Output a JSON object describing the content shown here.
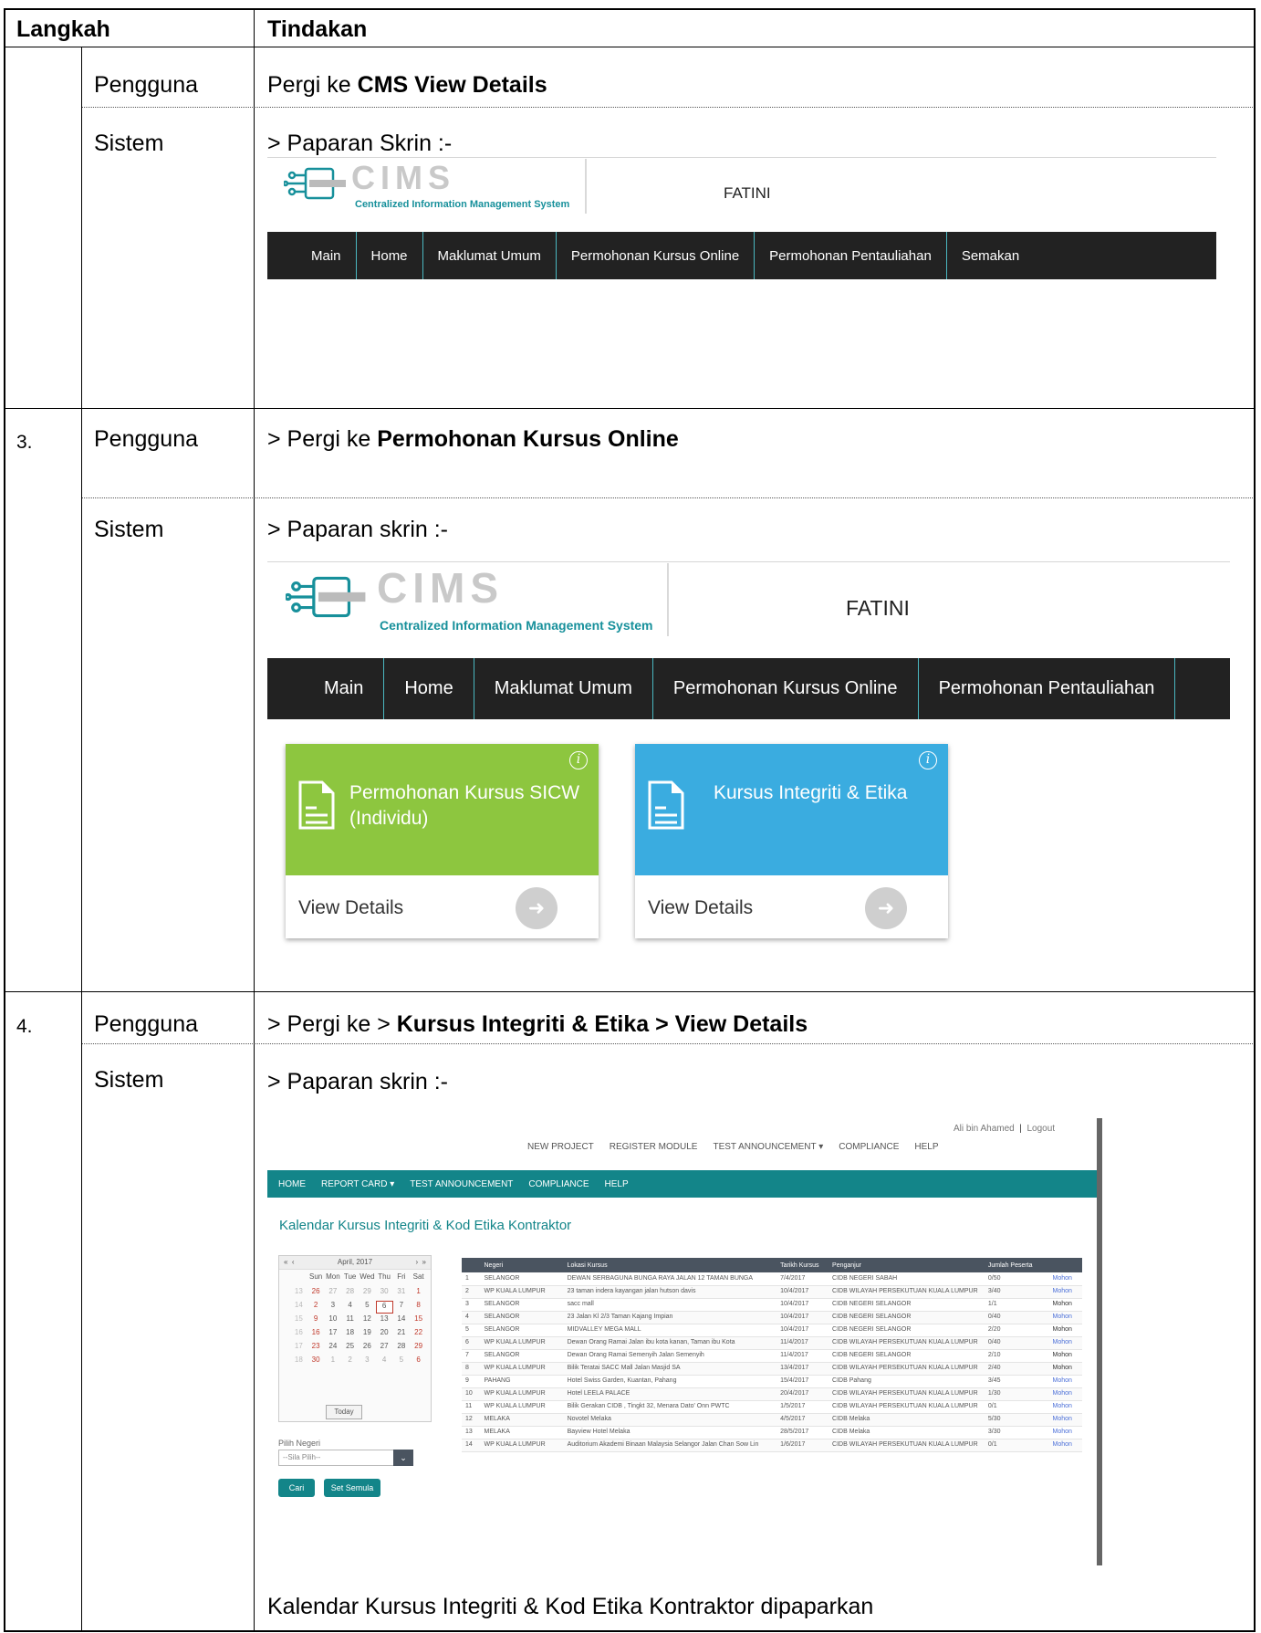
{
  "table": {
    "header_left": "Langkah",
    "header_right": "Tindakan"
  },
  "rows": [
    {
      "num": "",
      "actor": "Pengguna",
      "text_prefix": "Pergi ke ",
      "text_bold": "CMS View Details"
    },
    {
      "num": "",
      "actor": "Sistem",
      "text": "> Paparan Skrin :-"
    },
    {
      "num": "3.",
      "actor": "Pengguna",
      "text_prefix": "> Pergi ke ",
      "text_bold": "Permohonan Kursus Online"
    },
    {
      "num": "",
      "actor": "Sistem",
      "text": "> Paparan skrin :-"
    },
    {
      "num": "4.",
      "actor": "Pengguna",
      "text_prefix": "> Pergi ke > ",
      "text_bold": "Kursus Integriti & Etika > View Details"
    },
    {
      "num": "",
      "actor": "Sistem",
      "text": "> Paparan skrin :-"
    }
  ],
  "footer_text": "Kalendar Kursus Integriti & Kod Etika Kontraktor dipaparkan",
  "cims": {
    "logo_text": "CIMS",
    "subtitle": "Centralized Information Management System",
    "user": "FATINI",
    "nav": [
      "Main",
      "Home",
      "Maklumat Umum",
      "Permohonan Kursus Online",
      "Permohonan Pentauliahan",
      "Semakan"
    ]
  },
  "tiles": [
    {
      "title": "Permohonan Kursus SICW (Individu)",
      "link": "View Details",
      "color": "#8dc63f"
    },
    {
      "title": "Kursus Integriti & Etika",
      "link": "View Details",
      "color": "#3aace0"
    }
  ],
  "kal": {
    "user": "Ali bin Ahamed",
    "logout": "Logout",
    "toplinks": [
      "NEW PROJECT",
      "REGISTER MODULE",
      "TEST ANNOUNCEMENT ▾",
      "COMPLIANCE",
      "HELP"
    ],
    "nav": [
      "HOME",
      "REPORT CARD ▾",
      "TEST ANNOUNCEMENT",
      "COMPLIANCE",
      "HELP"
    ],
    "title": "Kalendar Kursus Integriti & Kod Etika Kontraktor",
    "cal_month": "April, 2017",
    "cal_days": [
      "Sun",
      "Mon",
      "Tue",
      "Wed",
      "Thu",
      "Fri",
      "Sat"
    ],
    "cal_weeks": [
      [
        "13",
        "26",
        "27",
        "28",
        "29",
        "30",
        "31",
        "1"
      ],
      [
        "14",
        "2",
        "3",
        "4",
        "5",
        "6",
        "7",
        "8"
      ],
      [
        "15",
        "9",
        "10",
        "11",
        "12",
        "13",
        "14",
        "15"
      ],
      [
        "16",
        "16",
        "17",
        "18",
        "19",
        "20",
        "21",
        "22"
      ],
      [
        "17",
        "23",
        "24",
        "25",
        "26",
        "27",
        "28",
        "29"
      ],
      [
        "18",
        "30",
        "1",
        "2",
        "3",
        "4",
        "5",
        "6"
      ]
    ],
    "today": "Today",
    "pilih_label": "Pilih Negeri",
    "select_placeholder": "--Sila Pilih--",
    "btn_cari": "Cari",
    "btn_set": "Set Semula",
    "columns": [
      "",
      "Negeri",
      "Lokasi Kursus",
      "Tarikh Kursus",
      "Penganjur",
      "Jumlah Peserta",
      ""
    ],
    "rows": [
      [
        "1",
        "SELANGOR",
        "DEWAN SERBAGUNA BUNGA RAYA JALAN 12 TAMAN BUNGA",
        "7/4/2017",
        "CIDB NEGERI SABAH",
        "0/50",
        "Mohon"
      ],
      [
        "2",
        "WP KUALA LUMPUR",
        "23 taman indera kayangan jalan hutson davis",
        "10/4/2017",
        "CIDB WILAYAH PERSEKUTUAN KUALA LUMPUR",
        "3/40",
        "Mohon"
      ],
      [
        "3",
        "SELANGOR",
        "sacc mall",
        "10/4/2017",
        "CIDB NEGERI SELANGOR",
        "1/1",
        "Mohon"
      ],
      [
        "4",
        "SELANGOR",
        "23 Jalan Kl 2/3 Taman Kajang Impian",
        "10/4/2017",
        "CIDB NEGERI SELANGOR",
        "0/40",
        "Mohon"
      ],
      [
        "5",
        "SELANGOR",
        "MIDVALLEY MEGA MALL",
        "10/4/2017",
        "CIDB NEGERI SELANGOR",
        "2/20",
        "Mohon"
      ],
      [
        "6",
        "WP KUALA LUMPUR",
        "Dewan Orang Ramai Jalan ibu kota kanan, Taman ibu Kota",
        "11/4/2017",
        "CIDB WILAYAH PERSEKUTUAN KUALA LUMPUR",
        "0/40",
        "Mohon"
      ],
      [
        "7",
        "SELANGOR",
        "Dewan Orang Ramai Semenyih Jalan Semenyih",
        "11/4/2017",
        "CIDB NEGERI SELANGOR",
        "2/10",
        "Mohon"
      ],
      [
        "8",
        "WP KUALA LUMPUR",
        "Bilik Teratai SACC Mall Jalan Masjid SA",
        "13/4/2017",
        "CIDB WILAYAH PERSEKUTUAN KUALA LUMPUR",
        "2/40",
        "Mohon"
      ],
      [
        "9",
        "PAHANG",
        "Hotel Swiss Garden, Kuantan, Pahang",
        "15/4/2017",
        "CIDB Pahang",
        "3/45",
        "Mohon"
      ],
      [
        "10",
        "WP KUALA LUMPUR",
        "Hotel LEELA PALACE",
        "20/4/2017",
        "CIDB WILAYAH PERSEKUTUAN KUALA LUMPUR",
        "1/30",
        "Mohon"
      ],
      [
        "11",
        "WP KUALA LUMPUR",
        "Bilik Gerakan CIDB , Tingkt 32, Menara Dato' Onn PWTC",
        "1/5/2017",
        "CIDB WILAYAH PERSEKUTUAN KUALA LUMPUR",
        "0/1",
        "Mohon"
      ],
      [
        "12",
        "MELAKA",
        "Novotel Melaka",
        "4/5/2017",
        "CIDB Melaka",
        "5/30",
        "Mohon"
      ],
      [
        "13",
        "MELAKA",
        "Bayview Hotel Melaka",
        "28/5/2017",
        "CIDB Melaka",
        "3/30",
        "Mohon"
      ],
      [
        "14",
        "WP KUALA LUMPUR",
        "Auditorium Akademi Binaan Malaysia Selangor Jalan Chan Sow Lin",
        "1/6/2017",
        "CIDB WILAYAH PERSEKUTUAN KUALA LUMPUR",
        "0/1",
        "Mohon"
      ]
    ]
  }
}
